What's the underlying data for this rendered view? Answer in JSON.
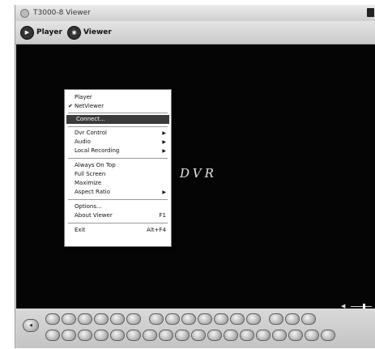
{
  "window": {
    "title": "T3000-8 Viewer"
  },
  "toolbar": {
    "player_label": "Player",
    "viewer_label": "Viewer"
  },
  "video": {
    "overlay_text": "DVR"
  },
  "menu": {
    "items": [
      {
        "label": "Player"
      },
      {
        "label": "NetViewer",
        "checked": true
      },
      {
        "label": "Connect...",
        "highlighted": true
      },
      {
        "label": "Dvr Control",
        "submenu": true
      },
      {
        "label": "Audio",
        "submenu": true
      },
      {
        "label": "Local Recording",
        "submenu": true
      },
      {
        "label": "Always On Top"
      },
      {
        "label": "Full Screen"
      },
      {
        "label": "Maximize"
      },
      {
        "label": "Aspect Ratio",
        "submenu": true
      },
      {
        "label": "Options..."
      },
      {
        "label": "About Viewer",
        "shortcut": "F1"
      },
      {
        "label": "Exit",
        "shortcut": "Alt+F4"
      }
    ],
    "check_glyph": "✔",
    "submenu_glyph": "▶"
  },
  "volume": {
    "level": 0.85,
    "icon": "speaker-icon"
  },
  "colors": {
    "video_bg": "#050505",
    "menu_highlight": "#3b3b3b"
  }
}
